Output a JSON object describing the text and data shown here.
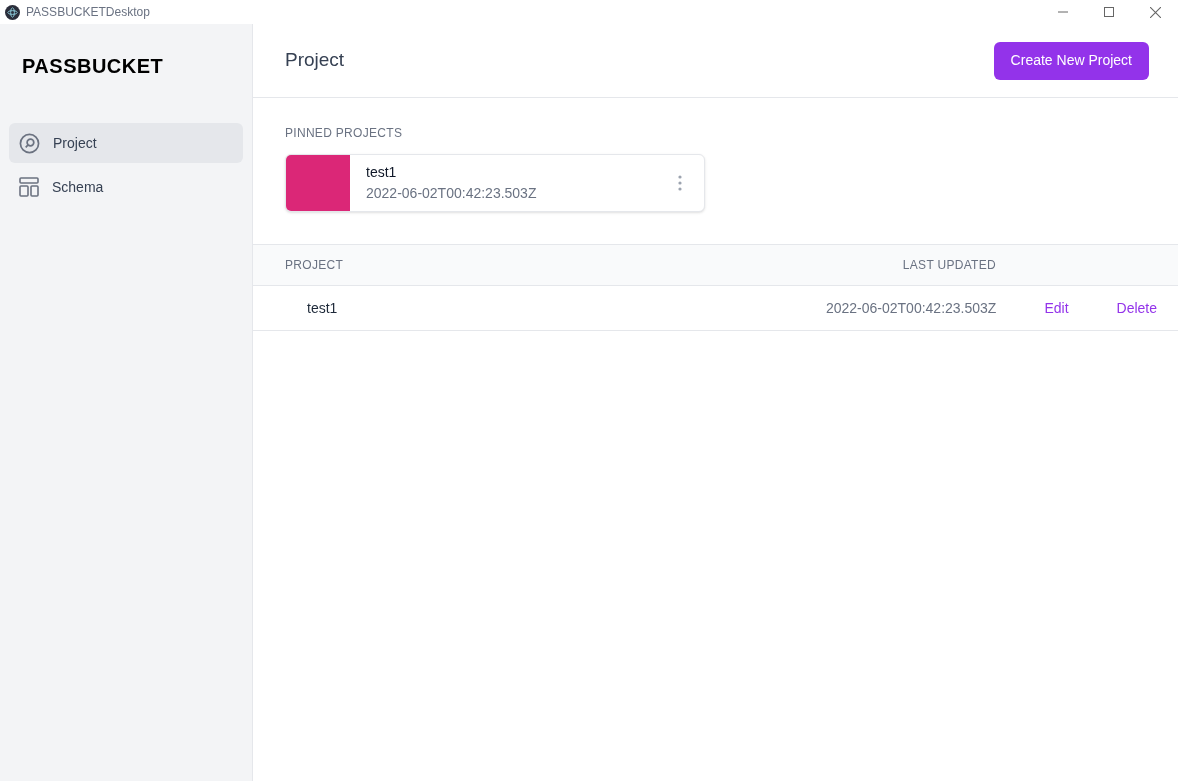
{
  "window": {
    "title": "PASSBUCKETDesktop"
  },
  "sidebar": {
    "logo": "PASSBUCKET",
    "items": [
      {
        "label": "Project",
        "kind": "project",
        "selected": true
      },
      {
        "label": "Schema",
        "kind": "schema",
        "selected": false
      }
    ]
  },
  "header": {
    "title": "Project",
    "button": "Create New Project"
  },
  "pinned": {
    "heading": "PINNED PROJECTS",
    "items": [
      {
        "name": "test1",
        "date": "2022-06-02T00:42:23.503Z",
        "color": "#db2777"
      }
    ]
  },
  "table": {
    "columns": [
      "PROJECT",
      "LAST UPDATED"
    ],
    "rows": [
      {
        "name": "test1",
        "updated": "2022-06-02T00:42:23.503Z",
        "actions": [
          "Edit",
          "Delete"
        ]
      }
    ]
  }
}
